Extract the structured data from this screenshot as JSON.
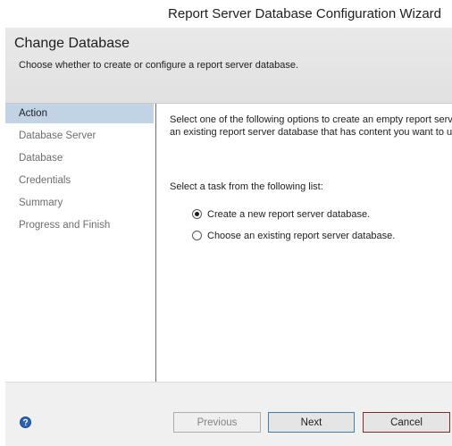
{
  "window": {
    "title": "Report Server Database Configuration Wizard"
  },
  "header": {
    "title": "Change Database",
    "subtitle": "Choose whether to create or configure a report server database."
  },
  "sidebar": {
    "items": [
      {
        "label": "Action",
        "selected": true
      },
      {
        "label": "Database Server",
        "selected": false
      },
      {
        "label": "Database",
        "selected": false
      },
      {
        "label": "Credentials",
        "selected": false
      },
      {
        "label": "Summary",
        "selected": false
      },
      {
        "label": "Progress and Finish",
        "selected": false
      }
    ]
  },
  "content": {
    "intro_lines": [
      "Select one of the following options to create an empty report serv",
      "an existing report server database that has content you want to u"
    ],
    "task_prompt": "Select a task from the following list:",
    "options": [
      {
        "label": "Create a new report server database.",
        "checked": true
      },
      {
        "label": "Choose an existing report server database.",
        "checked": false
      }
    ]
  },
  "footer": {
    "help_icon": "help-icon",
    "previous_label": "Previous",
    "next_label": "Next",
    "cancel_label": "Cancel",
    "previous_enabled": false
  },
  "colors": {
    "selected_nav_background": "#c3d3e6",
    "next_button_border": "#3c7fb1",
    "cancel_button_border": "#7a2b2b",
    "help_icon": "#2a62b4"
  }
}
